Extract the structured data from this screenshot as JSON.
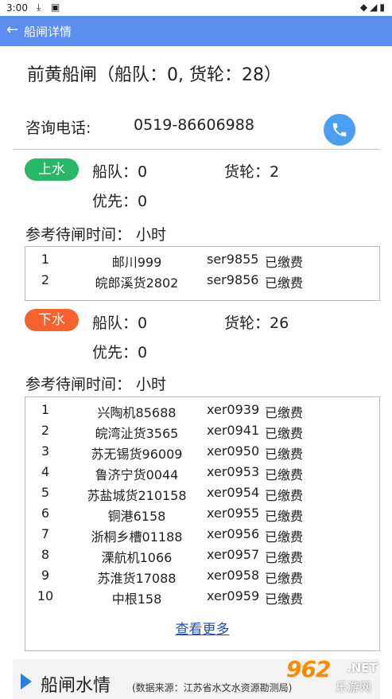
{
  "status_bar": {
    "time": "3:00",
    "download_icon": "download-icon",
    "app_icon": "app-icon"
  },
  "app_bar": {
    "back_icon": "arrow-left-icon",
    "title": "船闸详情"
  },
  "lock": {
    "summary": "前黄船闸（船队：0, 货轮：28）",
    "phone_label": "咨询电话:",
    "phone_number": "0519-86606988",
    "call_icon": "phone-icon"
  },
  "upstream": {
    "badge": "上水",
    "fleet": "船队：0",
    "freighter": "货轮：2",
    "priority": "优先：0",
    "wait_time": "参考待闸时间：  小时",
    "rows": [
      {
        "idx": "1",
        "ship": "邮川999",
        "code": "ser9855",
        "fee": "已缴费"
      },
      {
        "idx": "2",
        "ship": "皖郎溪货2802",
        "code": "ser9856",
        "fee": "已缴费"
      }
    ]
  },
  "downstream": {
    "badge": "下水",
    "fleet": "船队：0",
    "freighter": "货轮：26",
    "priority": "优先：0",
    "wait_time": "参考待闸时间：  小时",
    "rows": [
      {
        "idx": "1",
        "ship": "兴陶机85688",
        "code": "xer0939",
        "fee": "已缴费"
      },
      {
        "idx": "2",
        "ship": "皖湾沚货3565",
        "code": "xer0941",
        "fee": "已缴费"
      },
      {
        "idx": "3",
        "ship": "苏无锡货96009",
        "code": "xer0950",
        "fee": "已缴费"
      },
      {
        "idx": "4",
        "ship": "鲁济宁货0044",
        "code": "xer0953",
        "fee": "已缴费"
      },
      {
        "idx": "5",
        "ship": "苏盐城货210158",
        "code": "xer0954",
        "fee": "已缴费"
      },
      {
        "idx": "6",
        "ship": "铜港6158",
        "code": "xer0955",
        "fee": "已缴费"
      },
      {
        "idx": "7",
        "ship": "浙桐乡槽01188",
        "code": "xer0956",
        "fee": "已缴费"
      },
      {
        "idx": "8",
        "ship": "溧航机1066",
        "code": "xer0957",
        "fee": "已缴费"
      },
      {
        "idx": "9",
        "ship": "苏淮货17088",
        "code": "xer0958",
        "fee": "已缴费"
      },
      {
        "idx": "10",
        "ship": "中根158",
        "code": "xer0959",
        "fee": "已缴费"
      }
    ],
    "more": "查看更多"
  },
  "water_section": {
    "title": "船闸水情",
    "source": "(数据来源：江苏省水文水资源勘测局)"
  },
  "watermark": {
    "number": "962",
    "net": ".NET",
    "text": "乐游网"
  },
  "colors": {
    "app_bar": "#5b8ef0",
    "upstream_badge": "#28b765",
    "downstream_badge": "#f5622e",
    "call_button": "#4a9ff0",
    "link": "#1f4fbf"
  }
}
